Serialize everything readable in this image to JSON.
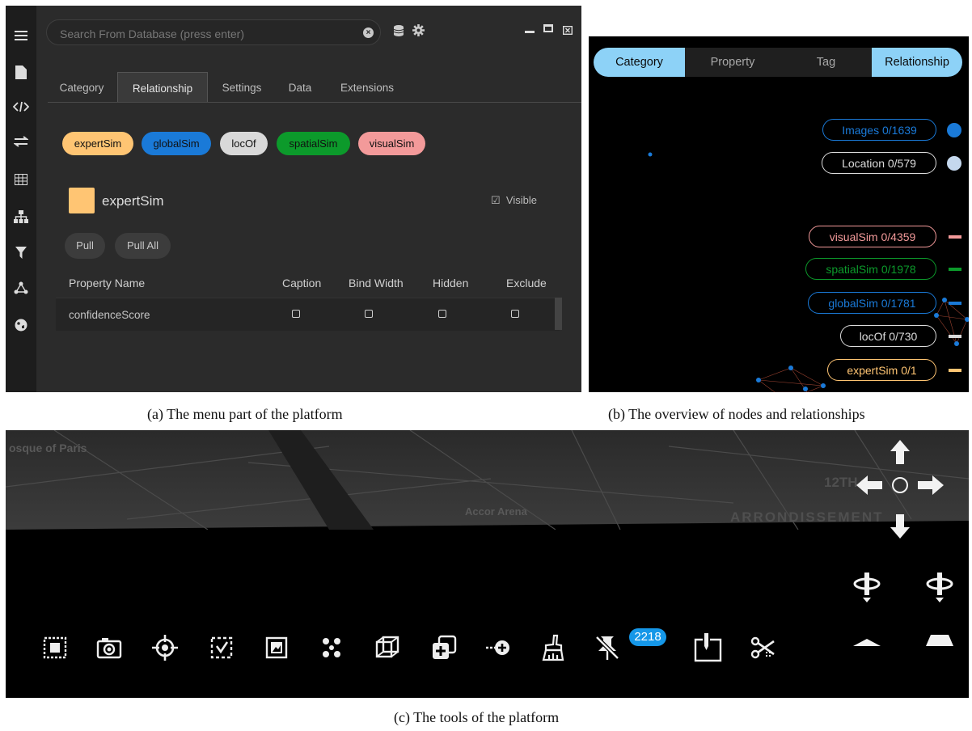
{
  "panel_a": {
    "search": {
      "placeholder": "Search From Database (press enter)"
    },
    "rail_icons": [
      "menu-icon",
      "file-icon",
      "code-icon",
      "transfer-icon",
      "table-icon",
      "hierarchy-icon",
      "filter-icon",
      "network-icon",
      "globe-icon"
    ],
    "tabs": [
      {
        "label": "Category"
      },
      {
        "label": "Relationship"
      },
      {
        "label": "Settings"
      },
      {
        "label": "Data"
      },
      {
        "label": "Extensions"
      }
    ],
    "relationship_pills": [
      {
        "label": "expertSim",
        "color": "#ffc573"
      },
      {
        "label": "globalSim",
        "color": "#1a7ad8"
      },
      {
        "label": "locOf",
        "color": "#d9d9d9"
      },
      {
        "label": "spatialSim",
        "color": "#0c9a2b"
      },
      {
        "label": "visualSim",
        "color": "#f39a9a"
      }
    ],
    "selected": {
      "name": "expertSim",
      "color": "#ffc573",
      "visible_label": "Visible"
    },
    "buttons": {
      "pull": "Pull",
      "pull_all": "Pull All"
    },
    "table": {
      "headers": [
        "Property Name",
        "Caption",
        "Bind Width",
        "Hidden",
        "Exclude"
      ],
      "rows": [
        {
          "name": "confidenceScore"
        }
      ]
    },
    "caption": "(a) The menu part of the platform"
  },
  "panel_b": {
    "segments": [
      {
        "label": "Category",
        "active": true
      },
      {
        "label": "Property",
        "active": false
      },
      {
        "label": "Tag",
        "active": false
      },
      {
        "label": "Relationship",
        "active": true
      }
    ],
    "node_legend": [
      {
        "label": "Images 0/1639",
        "color": "#1a7ad8"
      },
      {
        "label": "Location 0/579",
        "color": "#c5d8ee"
      }
    ],
    "rel_legend": [
      {
        "label": "visualSim 0/4359",
        "color": "#f39a9a"
      },
      {
        "label": "spatialSim 0/1978",
        "color": "#0c9a2b"
      },
      {
        "label": "globalSim 0/1781",
        "color": "#1a7ad8"
      },
      {
        "label": "locOf 0/730",
        "color": "#d9d9d9"
      },
      {
        "label": "expertSim 0/1",
        "color": "#ffc573"
      }
    ],
    "caption": "(b) The overview of nodes and relationships"
  },
  "panel_c": {
    "map_labels": {
      "mosque": "osque of Paris",
      "arena": "Accor Arena",
      "arr1": "12TH",
      "arr2": "ARRONDISSEMENT"
    },
    "tools": [
      "select-area-icon",
      "camera-icon",
      "crosshair-icon",
      "check-box-icon",
      "image-box-icon",
      "cluster-icon",
      "cube-icon",
      "add-layer-icon",
      "add-node-icon",
      "brush-icon",
      "pin-off-icon",
      "edit-box-icon",
      "scissors-icon"
    ],
    "pin_badge": "2218",
    "caption": "(c) The tools of the platform"
  }
}
